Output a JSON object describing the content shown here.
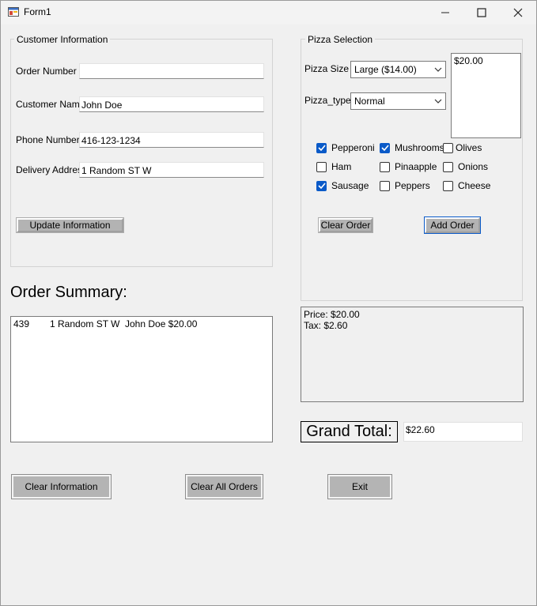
{
  "window": {
    "title": "Form1"
  },
  "customer": {
    "group_title": "Customer Information",
    "order_number_label": "Order Number",
    "order_number_value": "",
    "customer_name_label": "Customer Name",
    "customer_name_value": "John Doe",
    "phone_label": "Phone Number",
    "phone_value": "416-123-1234",
    "address_label": "Delivery Address",
    "address_value": "1 Random ST W",
    "update_button": "Update Information"
  },
  "pizza": {
    "group_title": "Pizza Selection",
    "size_label": "Pizza Size",
    "size_value": "Large ($14.00)",
    "type_label": "Pizza_type",
    "type_value": "Normal",
    "price_list": [
      "$20.00"
    ],
    "toppings": [
      {
        "label": "Pepperoni",
        "checked": true
      },
      {
        "label": "Mushrooms",
        "checked": true
      },
      {
        "label": "Olives",
        "checked": false
      },
      {
        "label": "Ham",
        "checked": false
      },
      {
        "label": "Pinaapple",
        "checked": false
      },
      {
        "label": "Onions",
        "checked": false
      },
      {
        "label": "Sausage",
        "checked": true
      },
      {
        "label": "Peppers",
        "checked": false
      },
      {
        "label": "Cheese",
        "checked": false
      }
    ],
    "clear_order_button": "Clear Order",
    "add_order_button": "Add Order"
  },
  "summary": {
    "title": "Order Summary:",
    "rows": [
      {
        "order_no": "439",
        "address": "1 Random ST W",
        "name_price": "John Doe $20.00"
      }
    ]
  },
  "totals": {
    "price_line": "Price: $20.00",
    "tax_line": "Tax: $2.60",
    "grand_total_label": "Grand Total:",
    "grand_total_value": "$22.60"
  },
  "actions": {
    "clear_information": "Clear Information",
    "clear_all_orders": "Clear All Orders",
    "exit": "Exit"
  },
  "colors": {
    "check_accent": "#0a5ac8",
    "button_gray": "#b3b3b3"
  }
}
